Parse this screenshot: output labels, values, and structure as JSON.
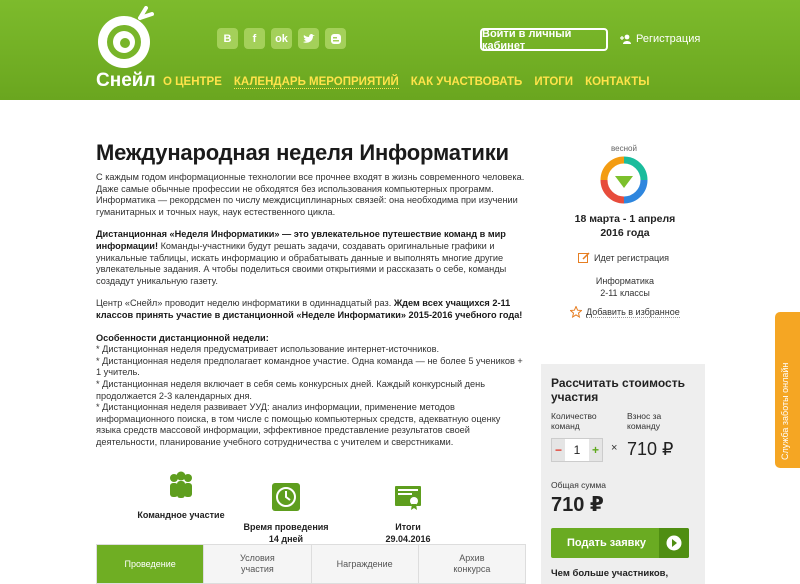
{
  "header": {
    "logo_text": "Снейл",
    "nav": [
      "О ЦЕНТРЕ",
      "КАЛЕНДАРЬ МЕРОПРИЯТИЙ",
      "КАК УЧАСТВОВАТЬ",
      "ИТОГИ",
      "КОНТАКТЫ"
    ],
    "socials": [
      "В",
      "f",
      "ok",
      "twitter",
      "blogger"
    ],
    "login_label": "Войти в личный кабинет",
    "register_label": "Регистрация",
    "colors": {
      "green": "#78b52a",
      "nav_yellow": "#ffe34a"
    }
  },
  "main": {
    "title": "Международная неделя Информатики",
    "intro": "С каждым годом информационные технологии все прочнее входят в жизнь современного человека. Даже самые обычные профессии не обходятся без использования компьютерных программ. Информатика — рекордсмен по числу междисциплинарных связей: она необходима при изучении гуманитарных и точных наук, наук естественного цикла.",
    "desc_bold": "Дистанционная «Неделя Информатики» — это увлекательное путешествие команд в мир информации!",
    "desc_rest": " Команды-участники будут решать задачи, создавать оригинальные графики и уникальные таблицы, искать информацию и обрабатывать данные и выполнять многие другие увлекательные задания. А чтобы поделиться своими открытиями и рассказать о себе, команды создадут уникальную газету.",
    "center_text": "Центр «Снейл» проводит неделю информатики в одиннадцатый раз. ",
    "center_bold": "Ждем всех учащихся 2-11 классов принять участие в дистанционной «Неделе Информатики» 2015-2016 учебного года!",
    "features_title": "Особенности дистанционной недели:",
    "features": [
      "* Дистанционная неделя предусматривает использование интернет-источников.",
      "* Дистанционная неделя предполагает командное участие. Одна команда — не более 5 учеников + 1 учитель.",
      "* Дистанционная неделя включает в себя семь конкурсных дней. Каждый конкурсный день продолжается 2-3 календарных дня.",
      "* Дистанционная неделя развивает УУД: анализ информации, применение методов информационного поиска, в том числе с помощью компьютерных средств, адекватную оценку языка средств массовой информации, эффективное представление результатов своей деятельности, планирование учебного сотрудничества с учителем и сверстниками."
    ],
    "stats": [
      {
        "label": "Командное участие",
        "icon": "team-icon"
      },
      {
        "label": "Время проведения\n14 дней",
        "icon": "clock-icon"
      },
      {
        "label": "Итоги\n29.04.2016",
        "icon": "certificate-icon"
      }
    ],
    "tabs": [
      "Проведение",
      "Условия\nучастия",
      "Награждение",
      "Архив\nконкурса"
    ]
  },
  "side": {
    "season": "весной",
    "date_range": "18 марта - 1 апреля",
    "year": "2016 года",
    "status": "Идет регистрация",
    "subject": "Информатика",
    "grades": "2-11 классы",
    "favorite": "Добавить в избранное"
  },
  "calc": {
    "title": "Рассчитать стоимость участия",
    "qty_label": "Количество\nкоманд",
    "fee_label": "Взнос за\nкоманду",
    "qty_value": "1",
    "times": "×",
    "fee": "710 ₽",
    "total_label": "Общая сумма",
    "total": "710 ₽",
    "submit": "Подать заявку",
    "more": "Чем больше участников,"
  },
  "support": "Служба заботы онлайн"
}
